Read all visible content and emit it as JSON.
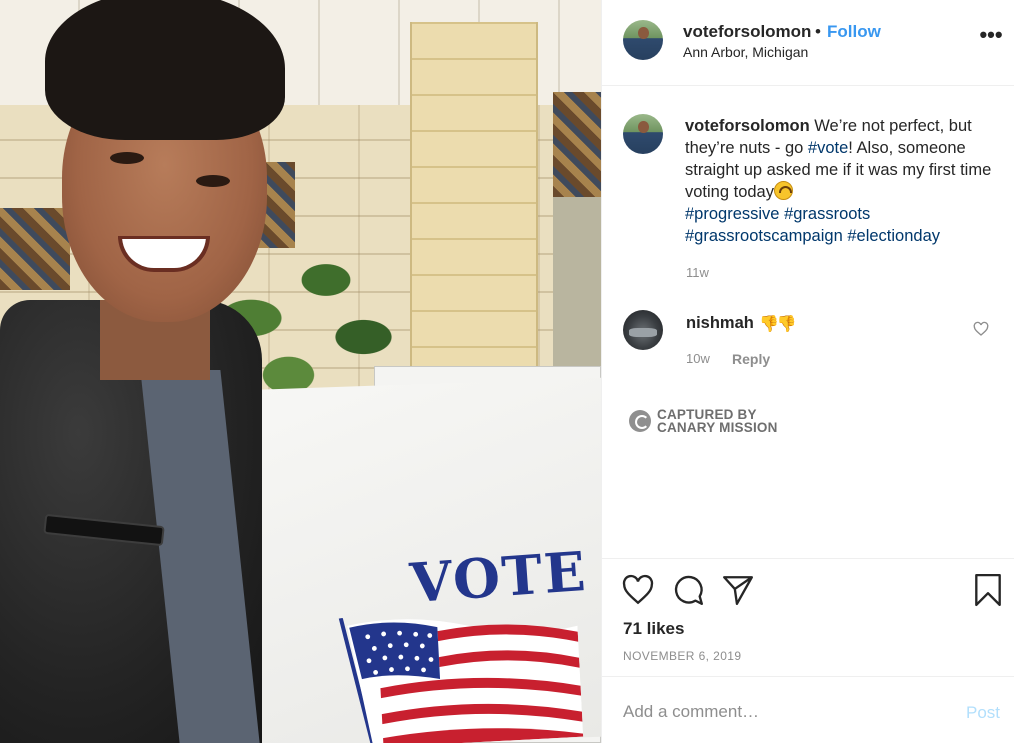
{
  "post": {
    "username": "voteforsolomon",
    "separator": "•",
    "follow_label": "Follow",
    "location": "Ann Arbor, Michigan",
    "more_icon": "more-horizontal-icon"
  },
  "photo": {
    "booth_text": "VOTE"
  },
  "caption": {
    "username": "voteforsolomon",
    "text_1": "We’re not perfect, but they’re nuts - go ",
    "tag_vote": "#vote",
    "text_2": "! Also, someone straight up asked me if it was my first time voting today",
    "emoji": "upside-down-face-emoji",
    "tags": [
      "#progressive",
      "#grassroots",
      "#grassrootscampaign",
      "#electionday"
    ],
    "time": "11w"
  },
  "comment": {
    "username": "nishmah",
    "text": "👎👎",
    "time": "10w",
    "reply_label": "Reply",
    "like_icon": "heart-outline-icon"
  },
  "watermark": {
    "line1": "CAPTURED BY",
    "line2": "CANARY MISSION"
  },
  "actions": {
    "icons": [
      "heart-icon",
      "comment-icon",
      "share-icon",
      "bookmark-icon"
    ],
    "likes": "71 likes",
    "date": "NOVEMBER 6, 2019"
  },
  "comment_bar": {
    "placeholder": "Add a comment…",
    "post_label": "Post"
  },
  "colors": {
    "link_blue": "#3897f0",
    "hashtag": "#00376b",
    "muted": "#8e8e8e",
    "post_disabled": "#b2dffc",
    "vote_blue": "#23368c"
  }
}
